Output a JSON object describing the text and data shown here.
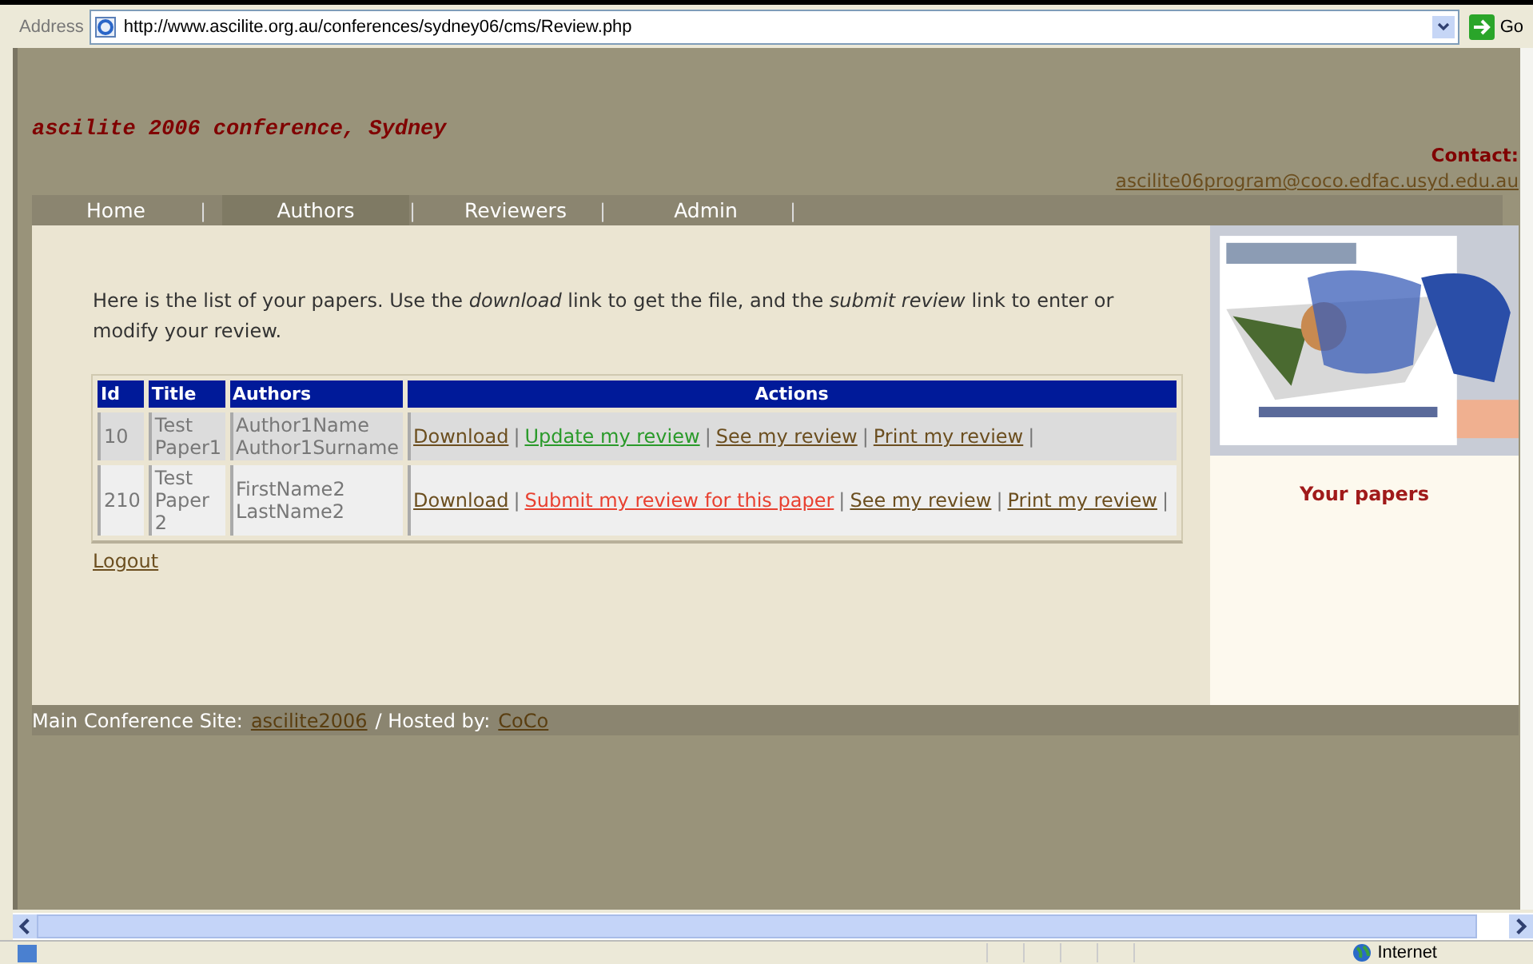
{
  "address_bar": {
    "label": "Address",
    "url": "http://www.ascilite.org.au/conferences/sydney06/cms/Review.php",
    "go": "Go"
  },
  "site_title": "ascilite 2006 conference, Sydney",
  "contact": {
    "label": "Contact:",
    "email": "ascilite06program@coco.edfac.usyd.edu.au"
  },
  "nav": [
    {
      "label": "Home",
      "selected": false
    },
    {
      "label": "Authors",
      "selected": true
    },
    {
      "label": "Reviewers",
      "selected": false
    },
    {
      "label": "Admin",
      "selected": false
    }
  ],
  "nav_separator": "|",
  "intro": "Here is the list of your papers. Use the *download* link to get the file, and the *submit review* link to enter or modify your review.",
  "table": {
    "columns": [
      "Id",
      "Title",
      "Authors",
      "Actions"
    ],
    "rows": [
      {
        "id": "10",
        "title": "Test Paper1",
        "authors": "Author1Name Author1Surname",
        "actions": [
          {
            "kind": "link",
            "label": "Download"
          },
          {
            "kind": "sep",
            "label": "|"
          },
          {
            "kind": "done",
            "label": "Update my review"
          },
          {
            "kind": "sep",
            "label": "|"
          },
          {
            "kind": "link",
            "label": "See my review"
          },
          {
            "kind": "sep",
            "label": "|"
          },
          {
            "kind": "link",
            "label": "Print my review"
          },
          {
            "kind": "sep",
            "label": "|"
          }
        ]
      },
      {
        "id": "210",
        "title": "Test Paper 2",
        "authors": "FirstName2 LastName2",
        "actions": [
          {
            "kind": "link",
            "label": "Download"
          },
          {
            "kind": "sep",
            "label": "|"
          },
          {
            "kind": "todo",
            "label": "Submit my review for this paper"
          },
          {
            "kind": "sep",
            "label": "|"
          },
          {
            "kind": "link",
            "label": "See my review"
          },
          {
            "kind": "sep",
            "label": "|"
          },
          {
            "kind": "link",
            "label": "Print my review"
          },
          {
            "kind": "sep",
            "label": "|"
          }
        ]
      }
    ]
  },
  "logout": "Logout",
  "sidebar": {
    "heading": "Your papers"
  },
  "footer": {
    "site_label": "Main Conference Site:",
    "site_link": "ascilite2006",
    "hosted_label": "/ Hosted by:",
    "hosted_link": "CoCo"
  },
  "status_bar": {
    "zone": "Internet"
  }
}
